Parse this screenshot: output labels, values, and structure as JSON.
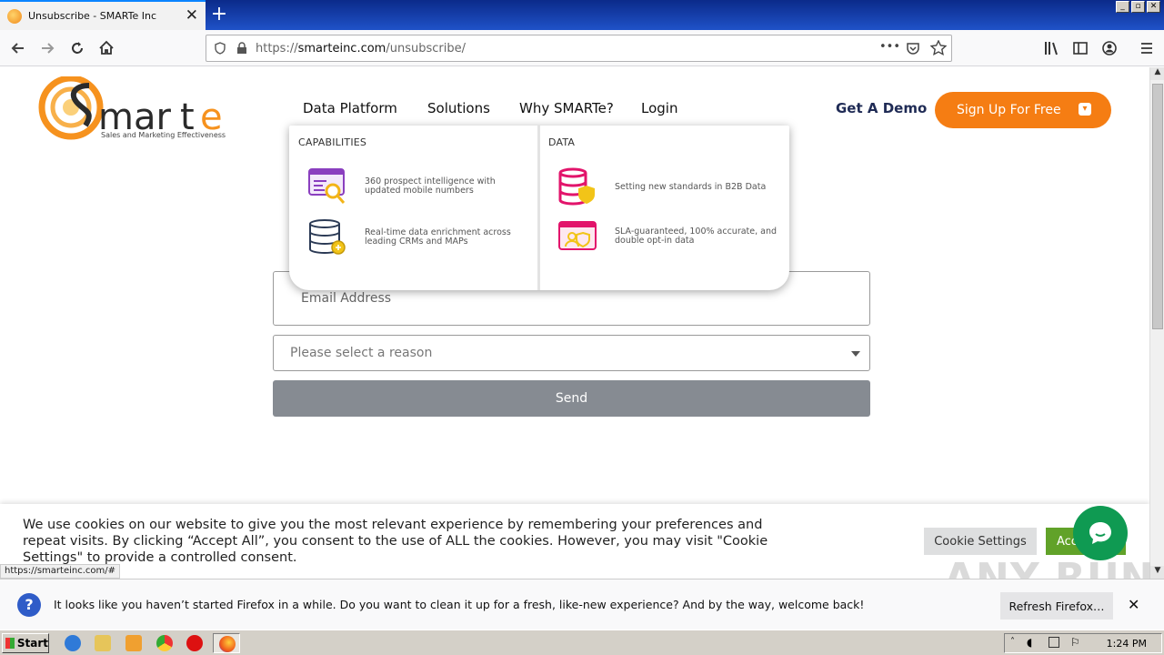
{
  "browser": {
    "tab_title": "Unsubscribe - SMARTe Inc",
    "tab_close": "✕",
    "new_tab": "+",
    "url_scheme": "https://",
    "url_host": "smarteinc.com",
    "url_path": "/unsubscribe/",
    "url_more": "•••"
  },
  "site": {
    "logo_text": "Smarte",
    "logo_tagline": "Sales and Marketing Effectiveness",
    "nav": [
      "Data Platform",
      "Solutions",
      "Why SMARTe?",
      "Login"
    ],
    "get_demo": "Get A Demo",
    "signup": "Sign Up For Free",
    "brand_color": "#f57d13"
  },
  "dropdown": {
    "capabilities_heading": "CAPABILITIES",
    "data_heading": "DATA",
    "capabilities": [
      {
        "icon": "search-profile-icon",
        "text": "360 prospect intelligence with updated mobile numbers"
      },
      {
        "icon": "database-icon",
        "text": "Real-time data enrichment across leading CRMs and MAPs"
      }
    ],
    "data": [
      {
        "icon": "database-shield-icon",
        "text": "Setting new standards in B2B Data"
      },
      {
        "icon": "verified-user-icon",
        "text": "SLA-guaranteed, 100% accurate, and double opt-in data"
      }
    ]
  },
  "form": {
    "email_placeholder": "Email Address",
    "reason_placeholder": "Please select a reason",
    "send": "Send"
  },
  "cookie": {
    "text": "We use cookies on our website to give you the most relevant experience by remembering your preferences and repeat visits. By clicking “Accept All”, you consent to the use of ALL the cookies. However, you may visit \"Cookie Settings\" to provide a controlled consent.",
    "settings": "Cookie Settings",
    "accept": "Acc"
  },
  "status_url": "https://smarteinc.com/#",
  "notification": {
    "message": "It looks like you haven’t started Firefox in a while. Do you want to clean it up for a fresh, like-new experience? And by the way, welcome back!",
    "refresh": "Refresh Firefox…",
    "close": "✕"
  },
  "watermark": "ANY RUN",
  "taskbar": {
    "start": "Start",
    "clock": "1:24 PM"
  }
}
